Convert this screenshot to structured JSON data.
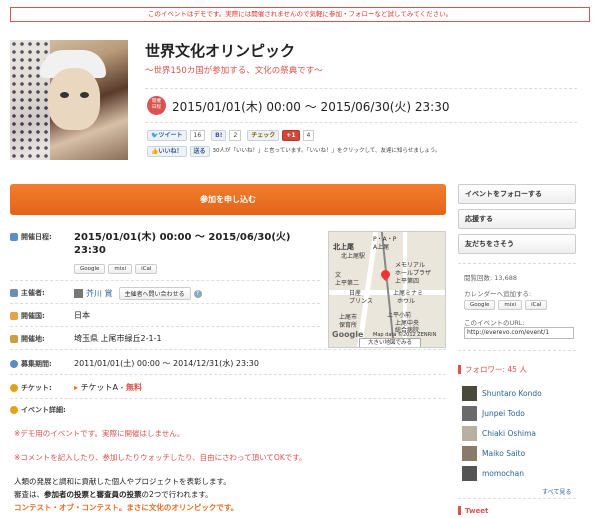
{
  "banner": "このイベントはデモです。実際には開催されませんので気軽に参加・フォローなど試してみてください。",
  "event": {
    "title": "世界文化オリンピック",
    "subtitle": "〜世界150カ国が参加する、文化の祭典です〜",
    "badge_line1": "開催",
    "badge_line2": "日程",
    "date_range": "2015/01/01(木) 00:00 〜 2015/06/30(火) 23:30"
  },
  "social": {
    "tweet_label": "ツイート",
    "tweet_count": "16",
    "bookmark_label": "B!",
    "bookmark_count": "2",
    "check_label": "チェック",
    "gplus_label": "+1",
    "gplus_count": "4",
    "like_label": "いいね！",
    "send_label": "送る",
    "fb_text": "30人が「いいね！」と言っています。「いいね！」をクリックして、友達に知らせましょう。"
  },
  "apply_label": "参加を申し込む",
  "details": {
    "date_label": "開催日程:",
    "date_line1": "2015/01/01(木) 00:00 〜 2015/06/30(火)",
    "date_line2": "23:30",
    "cal": [
      "Google",
      "mixi",
      "iCal"
    ],
    "organizer_label": "主催者:",
    "organizer_name": "芥川 賞",
    "organizer_btn": "主催者へ問い合わせる",
    "country_label": "開催国:",
    "country": "日本",
    "venue_label": "開催地:",
    "venue": "埼玉県 上尾市緑丘2-1-1",
    "recruit_label": "募集期間:",
    "recruit": "2011/01/01(土) 00:00 〜 2014/12/31(水) 23:30",
    "ticket_label": "チケット:",
    "ticket": "チケットA -",
    "ticket_price": "無料",
    "detail_label": "イベント詳細:",
    "note1": "※デモ用のイベントです。実際に開催はしません。",
    "note2": "※コメントを記入したり、参加したりウォッチしたり、自由にさわって頂いてOKです。",
    "body1": "人類の発展と調和に貢献した個人やプロジェクトを表彰します。",
    "body2a": "審査は、",
    "body2b": "参加者の投票と審査員の投票",
    "body2c": "の2つで行われます。",
    "body3": "コンテスト・オブ・コンテスト。まさに文化のオリンピックです。"
  },
  "map": {
    "labels": [
      "北上尾",
      "P・A・P",
      "A上尾",
      "北上尾駅",
      "文",
      "上平第二",
      "メモリアル",
      "ホールプラザ",
      "上平第四",
      "日産",
      "プリンス",
      "上尾ミナミ",
      "ホウル",
      "上尾市",
      "保育所",
      "上平小前",
      "上尾中央",
      "総合病院"
    ],
    "copyright": "Map data ©2012 ZENRIN",
    "logo": "Google",
    "big_map": "大きい地図でみる"
  },
  "sidebar": {
    "follow": "イベントをフォローする",
    "support": "応援する",
    "invite": "友だちをさそう",
    "views": "閲覧回数: 13,688",
    "cal_add": "カレンダーへ追加する:",
    "cal": [
      "Google",
      "mixi",
      "iCal"
    ],
    "url_label": "このイベントのURL:",
    "url": "http://everevo.com/event/1",
    "followers_label": "フォロワー: 45 人",
    "followers": [
      "Shuntaro Kondo",
      "Junpei Todo",
      "Chiaki Oshima",
      "Maiko Saito",
      "momochan"
    ],
    "see_all": "すべて見る",
    "tweet_heading": "Tweet"
  },
  "colors": {
    "accent": "#e96b20",
    "red": "#d9534f",
    "link": "#2a6496"
  }
}
